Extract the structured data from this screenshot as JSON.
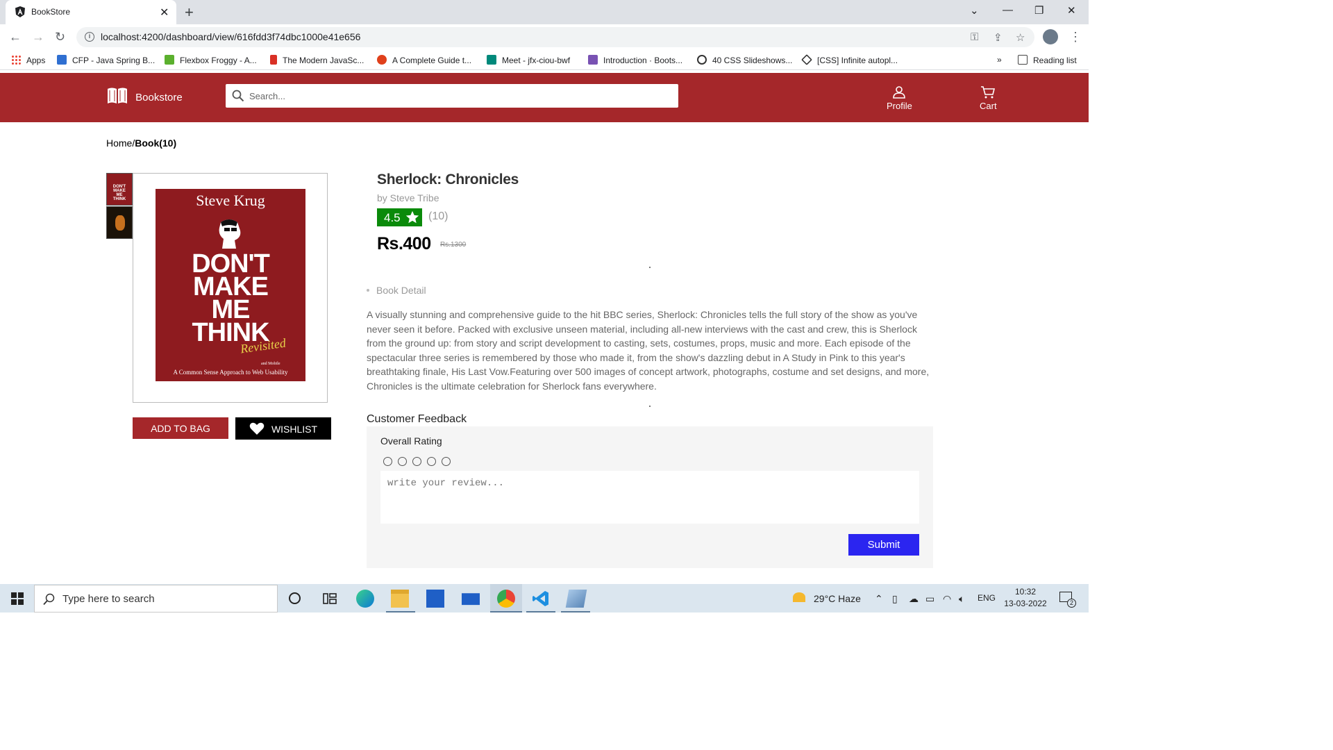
{
  "browser": {
    "tab_title": "BookStore",
    "url": "localhost:4200/dashboard/view/616fdd3f74dbc1000e41e656",
    "bookmarks": [
      {
        "label": "Apps",
        "color": "#4285f4"
      },
      {
        "label": "CFP - Java Spring B...",
        "color": "#2f6fd1"
      },
      {
        "label": "Flexbox Froggy - A...",
        "color": "#5bb02e"
      },
      {
        "label": "The Modern JavaSc...",
        "color": "#d93025"
      },
      {
        "label": "A Complete Guide t...",
        "color": "#e0401b"
      },
      {
        "label": "Meet - jfx-ciou-bwf",
        "color": "#00897b"
      },
      {
        "label": "Introduction · Boots...",
        "color": "#7952b3"
      },
      {
        "label": "40 CSS Slideshows...",
        "color": "#333333"
      },
      {
        "label": "[CSS] Infinite autopl...",
        "color": "#333333"
      }
    ],
    "more_label": "»",
    "reading_list": "Reading list"
  },
  "header": {
    "brand": "Bookstore",
    "search_placeholder": "Search...",
    "profile_label": "Profile",
    "cart_label": "Cart",
    "color": "#a5272a"
  },
  "breadcrumb": {
    "home": "Home/",
    "current": "Book(10)"
  },
  "cover": {
    "author": "Steve Krug",
    "line1": "DON'T",
    "line2": "MAKE",
    "line3": "ME",
    "line4": "THINK",
    "revisited": "Revisited",
    "subtitle": "A Common Sense Approach to Web Usability",
    "subtitle_insert": "and Mobile"
  },
  "actions": {
    "add_to_bag": "ADD TO BAG",
    "wishlist": "WISHLIST"
  },
  "book": {
    "title": "Sherlock: Chronicles",
    "author": "by Steve Tribe",
    "rating": "4.5",
    "rating_count": "(10)",
    "price": "Rs.400",
    "old_price": "Rs.1300",
    "detail_label": "Book Detail",
    "description": "A visually stunning and comprehensive guide to the hit BBC series, Sherlock: Chronicles tells the full story of the show as you've never seen it before. Packed with exclusive unseen material, including all-new interviews with the cast and crew, this is Sherlock from the ground up: from story and script development to casting, sets, costumes, props, music and more. Each episode of the spectacular three series is remembered by those who made it, from the show's dazzling debut in A Study in Pink to this year's breathtaking finale, His Last Vow.Featuring over 500 images of concept artwork, photographs, costume and set designs, and more, Chronicles is the ultimate celebration for Sherlock fans everywhere."
  },
  "feedback": {
    "title": "Customer Feedback",
    "overall": "Overall Rating",
    "star_count": 5,
    "review_placeholder": "write your review...",
    "submit": "Submit"
  },
  "taskbar": {
    "search_placeholder": "Type here to search",
    "weather": "29°C  Haze",
    "lang": "ENG",
    "time": "10:32",
    "date": "13-03-2022",
    "notifications": "2"
  }
}
